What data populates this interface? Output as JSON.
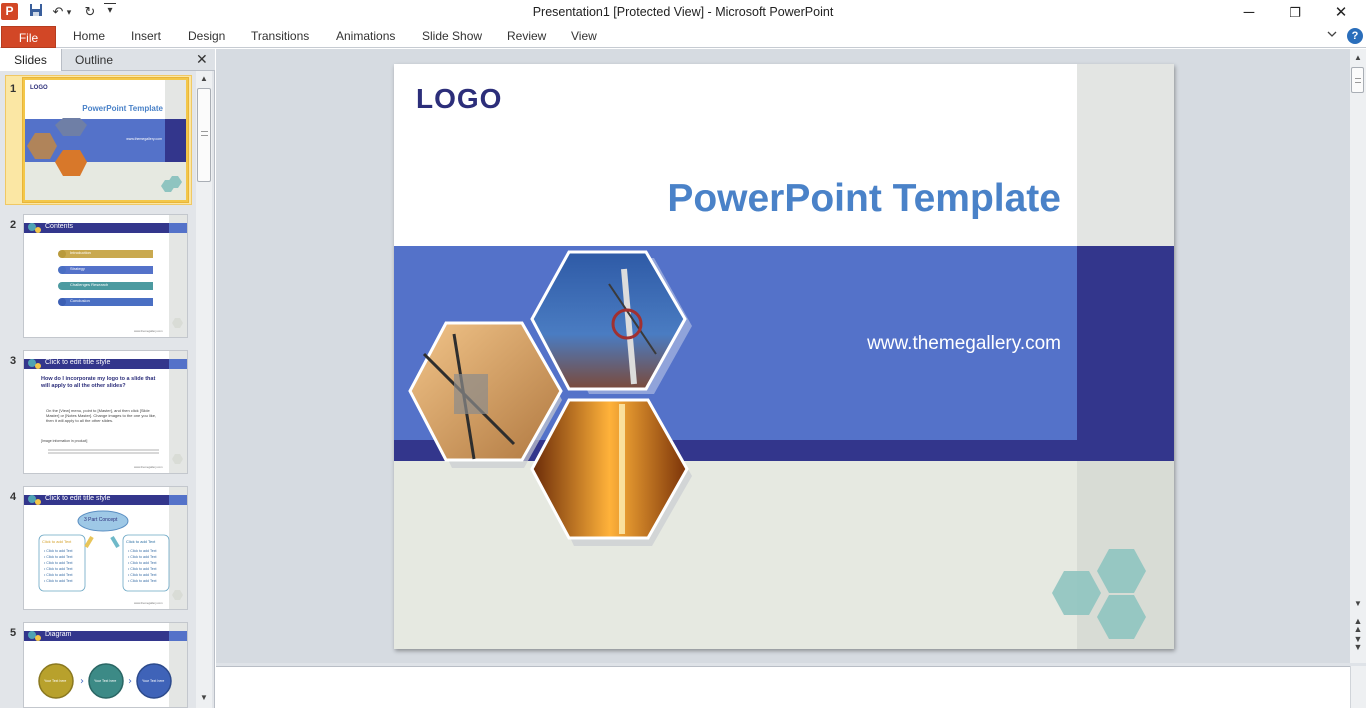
{
  "window": {
    "title": "Presentation1 [Protected View]  -  Microsoft PowerPoint",
    "app_icon_letter": "P",
    "minimize": "─",
    "restore": "❐",
    "close": "✕"
  },
  "quick_access": {
    "save": "💾",
    "undo": "↶",
    "undo_dropdown": "▾",
    "redo": "↻",
    "customize": "▾"
  },
  "ribbon": {
    "file": "File",
    "tabs": [
      "Home",
      "Insert",
      "Design",
      "Transitions",
      "Animations",
      "Slide Show",
      "Review",
      "View"
    ],
    "minimize_icon": "♡",
    "help": "?"
  },
  "left_pane": {
    "tab_slides": "Slides",
    "tab_outline": "Outline",
    "close": "✕",
    "slides": [
      {
        "num": "1",
        "logo": "LOGO",
        "title": "PowerPoint Template",
        "url": "www.themegallery.com"
      },
      {
        "num": "2",
        "title": "Contents",
        "items": [
          "Introduction",
          "Strategy",
          "Challenges    Research",
          "Conclusion"
        ],
        "footer": "www.themegallery.com"
      },
      {
        "num": "3",
        "title": "Click to edit title style",
        "bullet": "How do I incorporate my logo to a slide that will apply to all the other slides?",
        "body": "On the [View] menu, point to [Master], and then click [Slide Master] or [Notes Master]. Change images to the one you like, then it will apply to all the other slides.",
        "sub": "[Image information in product]",
        "footer": "www.themegallery.com"
      },
      {
        "num": "4",
        "title": "Click to edit title style",
        "concept": "3 Part Concept",
        "left_head": "Click to add Text",
        "right_head": "Click to add Text",
        "line": "• Click to add Text",
        "footer": "www.themegallery.com"
      },
      {
        "num": "5",
        "title": "Diagram",
        "circle_text": "Your Text here"
      }
    ]
  },
  "slide": {
    "logo": "LOGO",
    "title": "PowerPoint Template",
    "url": "www.themegallery.com"
  },
  "colors": {
    "file_tab": "#d24726",
    "title_blue": "#4a82c8",
    "band_blue": "#5472c9",
    "band_dark": "#33368c",
    "logo_navy": "#2c2e7a",
    "footer_gray": "#e6e9e1",
    "teal_hex": "#8fc4c0"
  }
}
